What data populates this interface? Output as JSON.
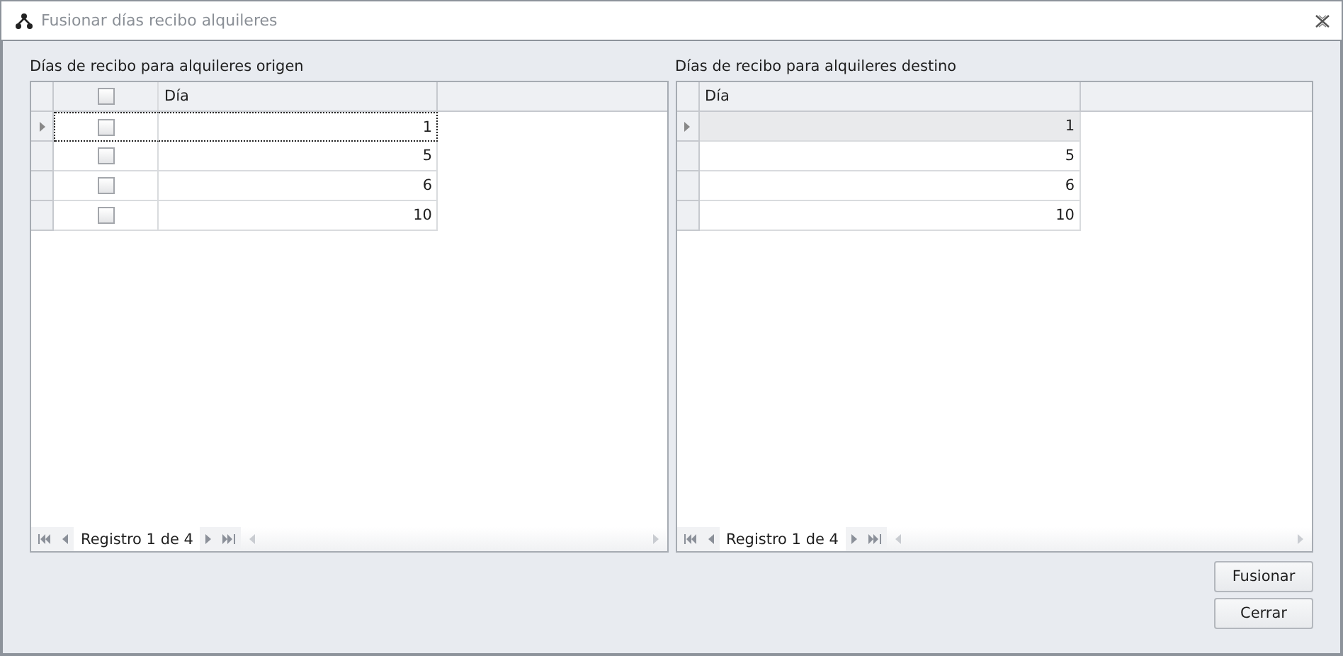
{
  "window": {
    "title": "Fusionar días recibo alquileres"
  },
  "grids": [
    {
      "label": "Días de recibo para alquileres origen",
      "kind": "checklist",
      "header_checked": false,
      "columns": [
        "Día"
      ],
      "rows": [
        {
          "selected": true,
          "checked": false,
          "cells": [
            "1"
          ]
        },
        {
          "selected": false,
          "checked": false,
          "cells": [
            "5"
          ]
        },
        {
          "selected": false,
          "checked": false,
          "cells": [
            "6"
          ]
        },
        {
          "selected": false,
          "checked": false,
          "cells": [
            "10"
          ]
        }
      ],
      "navigator": "Registro 1 de 4"
    },
    {
      "label": "Días de recibo para alquileres destino",
      "kind": "plain",
      "columns": [
        "Día"
      ],
      "rows": [
        {
          "selected": true,
          "cells": [
            "1"
          ]
        },
        {
          "selected": false,
          "cells": [
            "5"
          ]
        },
        {
          "selected": false,
          "cells": [
            "6"
          ]
        },
        {
          "selected": false,
          "cells": [
            "10"
          ]
        }
      ],
      "navigator": "Registro 1 de 4"
    }
  ],
  "buttons": [
    "Fusionar",
    "Cerrar"
  ]
}
